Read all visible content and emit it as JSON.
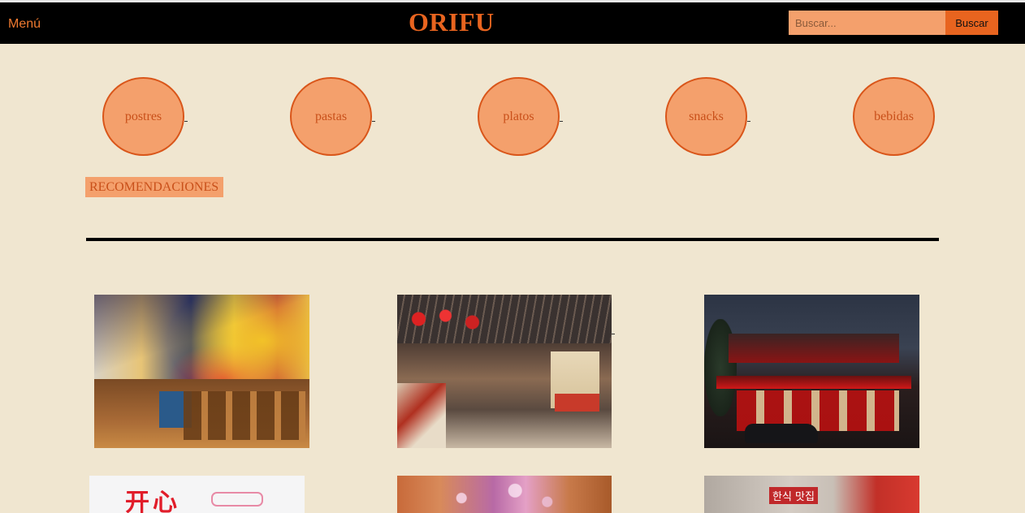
{
  "header": {
    "menu_label": "Menú",
    "brand": "ORIFU",
    "search_placeholder": "Buscar...",
    "search_button": "Buscar"
  },
  "categories": [
    {
      "label": "postres"
    },
    {
      "label": "pastas"
    },
    {
      "label": "platos"
    },
    {
      "label": "snacks"
    },
    {
      "label": "bebidas"
    }
  ],
  "recommendations": {
    "heading": "RECOMENDACIONES"
  },
  "colors": {
    "background": "#f0e6d0",
    "header": "#000000",
    "accent": "#e8641f",
    "circle_fill": "#f4a06c"
  },
  "photos": [
    {
      "subject": "colorful-mural-restaurant"
    },
    {
      "subject": "food-market-hall"
    },
    {
      "subject": "red-lit-pagoda-restaurant"
    },
    {
      "subject": "storefront-sign"
    },
    {
      "subject": "flower-ceiling-interior"
    },
    {
      "subject": "street-restaurant-signage"
    }
  ]
}
